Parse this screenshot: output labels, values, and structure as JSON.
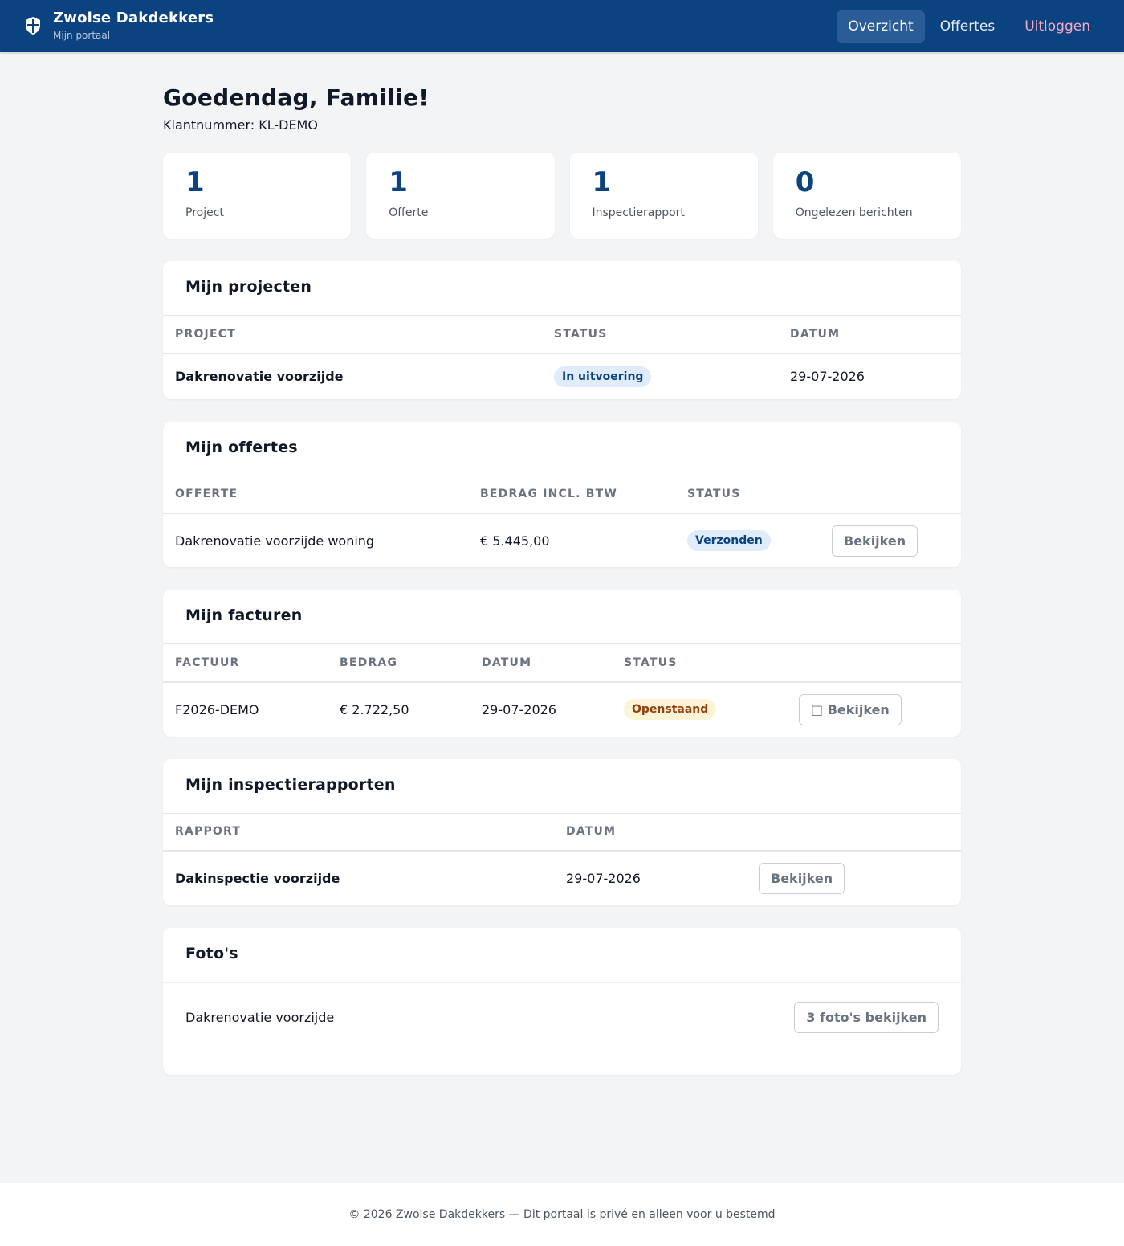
{
  "header": {
    "brand_name": "Zwolse Dakdekkers",
    "brand_sub": "Mijn portaal",
    "brand_icon": "shield-cross-icon",
    "nav": {
      "overzicht": "Overzicht",
      "offertes": "Offertes",
      "uitloggen": "Uitloggen"
    },
    "active_nav": "Overzicht"
  },
  "main": {
    "greeting": "Goedendag, Familie!",
    "client_number": "Klantnummer: KL-DEMO",
    "stats": [
      {
        "value": "1",
        "label": "Project"
      },
      {
        "value": "1",
        "label": "Offerte"
      },
      {
        "value": "1",
        "label": "Inspectierapport"
      },
      {
        "value": "0",
        "label": "Ongelezen berichten"
      }
    ]
  },
  "projects": {
    "title": "Mijn projecten",
    "columns": [
      "Project",
      "Status",
      "Datum"
    ],
    "rows": [
      {
        "project": "Dakrenovatie voorzijde",
        "status": "In uitvoering",
        "date": "29-07-2026"
      }
    ]
  },
  "quotes": {
    "title": "Mijn offertes",
    "columns": [
      "Offerte",
      "Bedrag incl. BTW",
      "Status",
      ""
    ],
    "rows": [
      {
        "quote": "Dakrenovatie voorzijde woning",
        "amount": "€ 5.445,00",
        "status": "Verzonden",
        "action": "Bekijken"
      }
    ]
  },
  "invoices": {
    "title": "Mijn facturen",
    "columns": [
      "Factuur",
      "Bedrag",
      "Datum",
      "Status",
      ""
    ],
    "rows": [
      {
        "invoice": "F2026-DEMO",
        "amount": "€ 2.722,50",
        "date": "29-07-2026",
        "status": "Openstaand",
        "action": "Bekijken",
        "action_icon": "□"
      }
    ]
  },
  "reports": {
    "title": "Mijn inspectierapporten",
    "columns": [
      "Rapport",
      "Datum",
      ""
    ],
    "rows": [
      {
        "report": "Dakinspectie voorzijde",
        "date": "29-07-2026",
        "action": "Bekijken"
      }
    ]
  },
  "photos": {
    "title": "Foto's",
    "items": [
      {
        "label": "Dakrenovatie voorzijde",
        "action": "3 foto's bekijken"
      }
    ]
  },
  "footer": {
    "text": "© 2026 Zwolse Dakdekkers — Dit portaal is privé en alleen voor u bestemd"
  },
  "colors": {
    "header_bg": "#0b4280",
    "accent": "#0b4280",
    "logout": "#f8a9c0",
    "badge_blue_bg": "#e0ecfa",
    "badge_yellow_bg": "#fdf3d7",
    "badge_yellow_text": "#92400e",
    "page_bg": "#f3f4f6"
  }
}
